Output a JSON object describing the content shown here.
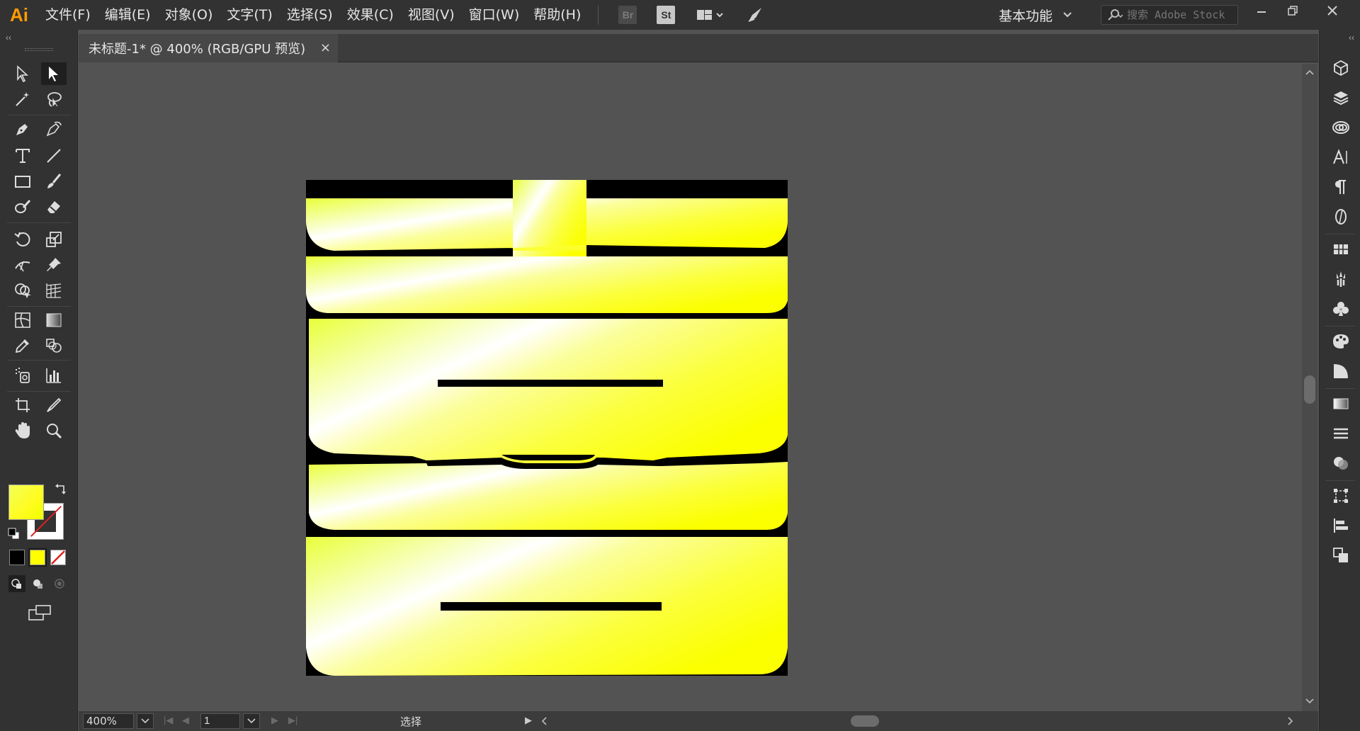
{
  "app": {
    "logo": "Ai",
    "menu": [
      "文件(F)",
      "编辑(E)",
      "对象(O)",
      "文字(T)",
      "选择(S)",
      "效果(C)",
      "视图(V)",
      "窗口(W)",
      "帮助(H)"
    ],
    "bridge_label": "Br",
    "stock_label": "St",
    "workspace": "基本功能",
    "search_placeholder": "搜索 Adobe Stock"
  },
  "document": {
    "tab_title": "未标题-1* @ 400% (RGB/GPU 预览)",
    "close_glyph": "×"
  },
  "status": {
    "zoom": "400%",
    "page": "1",
    "tool_status": "选择"
  },
  "colors": {
    "fill_gradient_start": "#ffffff",
    "fill_gradient_end": "#ffff00",
    "artboard_bg": "#000000",
    "accent": "#ff9a00"
  },
  "tools": [
    "selection-tool",
    "direct-selection-tool",
    "magic-wand-tool",
    "lasso-tool",
    "pen-tool",
    "curvature-tool",
    "type-tool",
    "line-segment-tool",
    "rectangle-tool",
    "paintbrush-tool",
    "shaper-tool",
    "eraser-tool",
    "rotate-tool",
    "scale-tool",
    "width-tool",
    "free-transform-tool",
    "shape-builder-tool",
    "perspective-grid-tool",
    "mesh-tool",
    "gradient-tool",
    "eyedropper-tool",
    "blend-tool",
    "symbol-sprayer-tool",
    "column-graph-tool",
    "artboard-tool",
    "slice-tool",
    "hand-tool",
    "zoom-tool"
  ],
  "right_panels": [
    "libraries-icon",
    "layers-icon",
    "cc-libraries-icon",
    "character-icon",
    "paragraph-icon",
    "opentype-icon",
    "swatches-icon",
    "brushes-icon",
    "symbols-icon",
    "color-icon",
    "color-guide-icon",
    "gradient-icon",
    "stroke-icon",
    "transparency-icon",
    "transform-icon",
    "align-icon",
    "pathfinder-icon"
  ]
}
